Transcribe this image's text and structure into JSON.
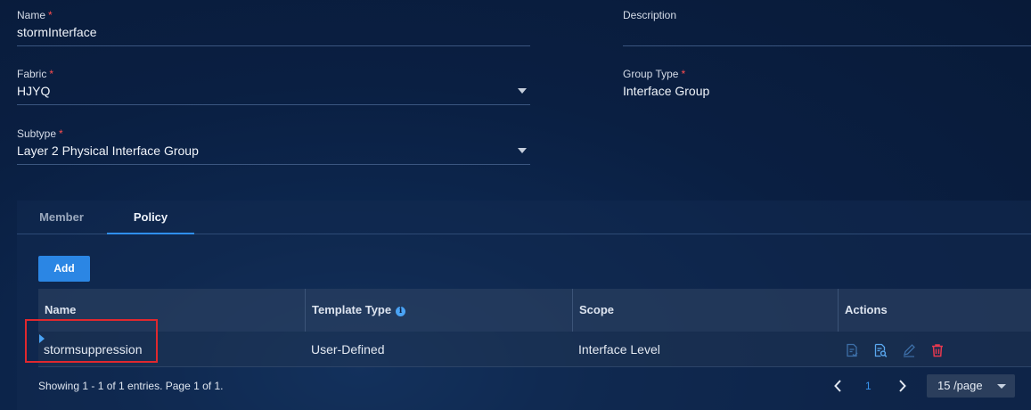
{
  "form": {
    "name": {
      "label": "Name",
      "required_mark": "*",
      "value": "stormInterface"
    },
    "description": {
      "label": "Description",
      "value": ""
    },
    "fabric": {
      "label": "Fabric",
      "required_mark": "*",
      "value": "HJYQ"
    },
    "group_type": {
      "label": "Group Type",
      "required_mark": "*",
      "value": "Interface Group"
    },
    "subtype": {
      "label": "Subtype",
      "required_mark": "*",
      "value": "Layer 2 Physical Interface Group"
    }
  },
  "tabs": [
    {
      "label": "Member",
      "active": false
    },
    {
      "label": "Policy",
      "active": true
    }
  ],
  "add_button": "Add",
  "table": {
    "headers": [
      "Name",
      "Template Type",
      "Scope",
      "Actions"
    ],
    "rows": [
      {
        "name": "stormsuppression",
        "template_type": "User-Defined",
        "scope": "Interface Level"
      }
    ],
    "actions": [
      "apply-icon",
      "preview-icon",
      "edit-icon",
      "delete-icon"
    ]
  },
  "footer": {
    "summary": "Showing 1 - 1 of 1 entries. Page 1 of 1.",
    "current_page": "1",
    "page_size": "15 /page"
  },
  "colors": {
    "accent": "#2b86e4",
    "required": "#ff4d4f",
    "delete": "#e8384f",
    "highlight": "#e0282e"
  }
}
